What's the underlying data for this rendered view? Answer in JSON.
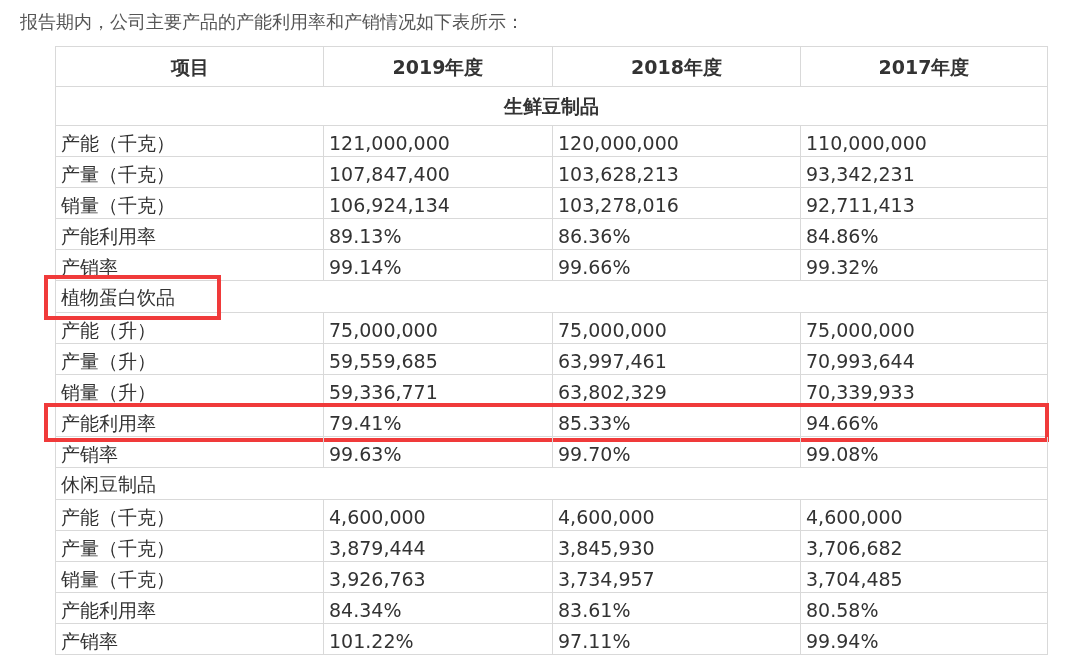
{
  "intro": "报告期内，公司主要产品的产能利用率和产销情况如下表所示：",
  "table": {
    "columns": [
      "项目",
      "2019年度",
      "2018年度",
      "2017年度"
    ],
    "sections": [
      {
        "title": "生鲜豆制品",
        "kind": "centered",
        "highlighted": false,
        "rows": [
          {
            "cells": [
              "产能（千克）",
              "121,000,000",
              "120,000,000",
              "110,000,000"
            ],
            "highlighted": false
          },
          {
            "cells": [
              "产量（千克）",
              "107,847,400",
              "103,628,213",
              "93,342,231"
            ],
            "highlighted": false
          },
          {
            "cells": [
              "销量（千克）",
              "106,924,134",
              "103,278,016",
              "92,711,413"
            ],
            "highlighted": false
          },
          {
            "cells": [
              "产能利用率",
              "89.13%",
              "86.36%",
              "84.86%"
            ],
            "highlighted": false
          },
          {
            "cells": [
              "产销率",
              "99.14%",
              "99.66%",
              "99.32%"
            ],
            "highlighted": false
          }
        ]
      },
      {
        "title": "植物蛋白饮品",
        "kind": "inline",
        "highlighted": true,
        "rows": [
          {
            "cells": [
              "产能（升）",
              "75,000,000",
              "75,000,000",
              "75,000,000"
            ],
            "highlighted": false
          },
          {
            "cells": [
              "产量（升）",
              "59,559,685",
              "63,997,461",
              "70,993,644"
            ],
            "highlighted": false
          },
          {
            "cells": [
              "销量（升）",
              "59,336,771",
              "63,802,329",
              "70,339,933"
            ],
            "highlighted": false
          },
          {
            "cells": [
              "产能利用率",
              "79.41%",
              "85.33%",
              "94.66%"
            ],
            "highlighted": true
          },
          {
            "cells": [
              "产销率",
              "99.63%",
              "99.70%",
              "99.08%"
            ],
            "highlighted": false
          }
        ]
      },
      {
        "title": "休闲豆制品",
        "kind": "inline",
        "highlighted": false,
        "rows": [
          {
            "cells": [
              "产能（千克）",
              "4,600,000",
              "4,600,000",
              "4,600,000"
            ],
            "highlighted": false
          },
          {
            "cells": [
              "产量（千克）",
              "3,879,444",
              "3,845,930",
              "3,706,682"
            ],
            "highlighted": false
          },
          {
            "cells": [
              "销量（千克）",
              "3,926,763",
              "3,734,957",
              "3,704,485"
            ],
            "highlighted": false
          },
          {
            "cells": [
              "产能利用率",
              "84.34%",
              "83.61%",
              "80.58%"
            ],
            "highlighted": false
          },
          {
            "cells": [
              "产销率",
              "101.22%",
              "97.11%",
              "99.94%"
            ],
            "highlighted": false
          }
        ]
      }
    ]
  }
}
